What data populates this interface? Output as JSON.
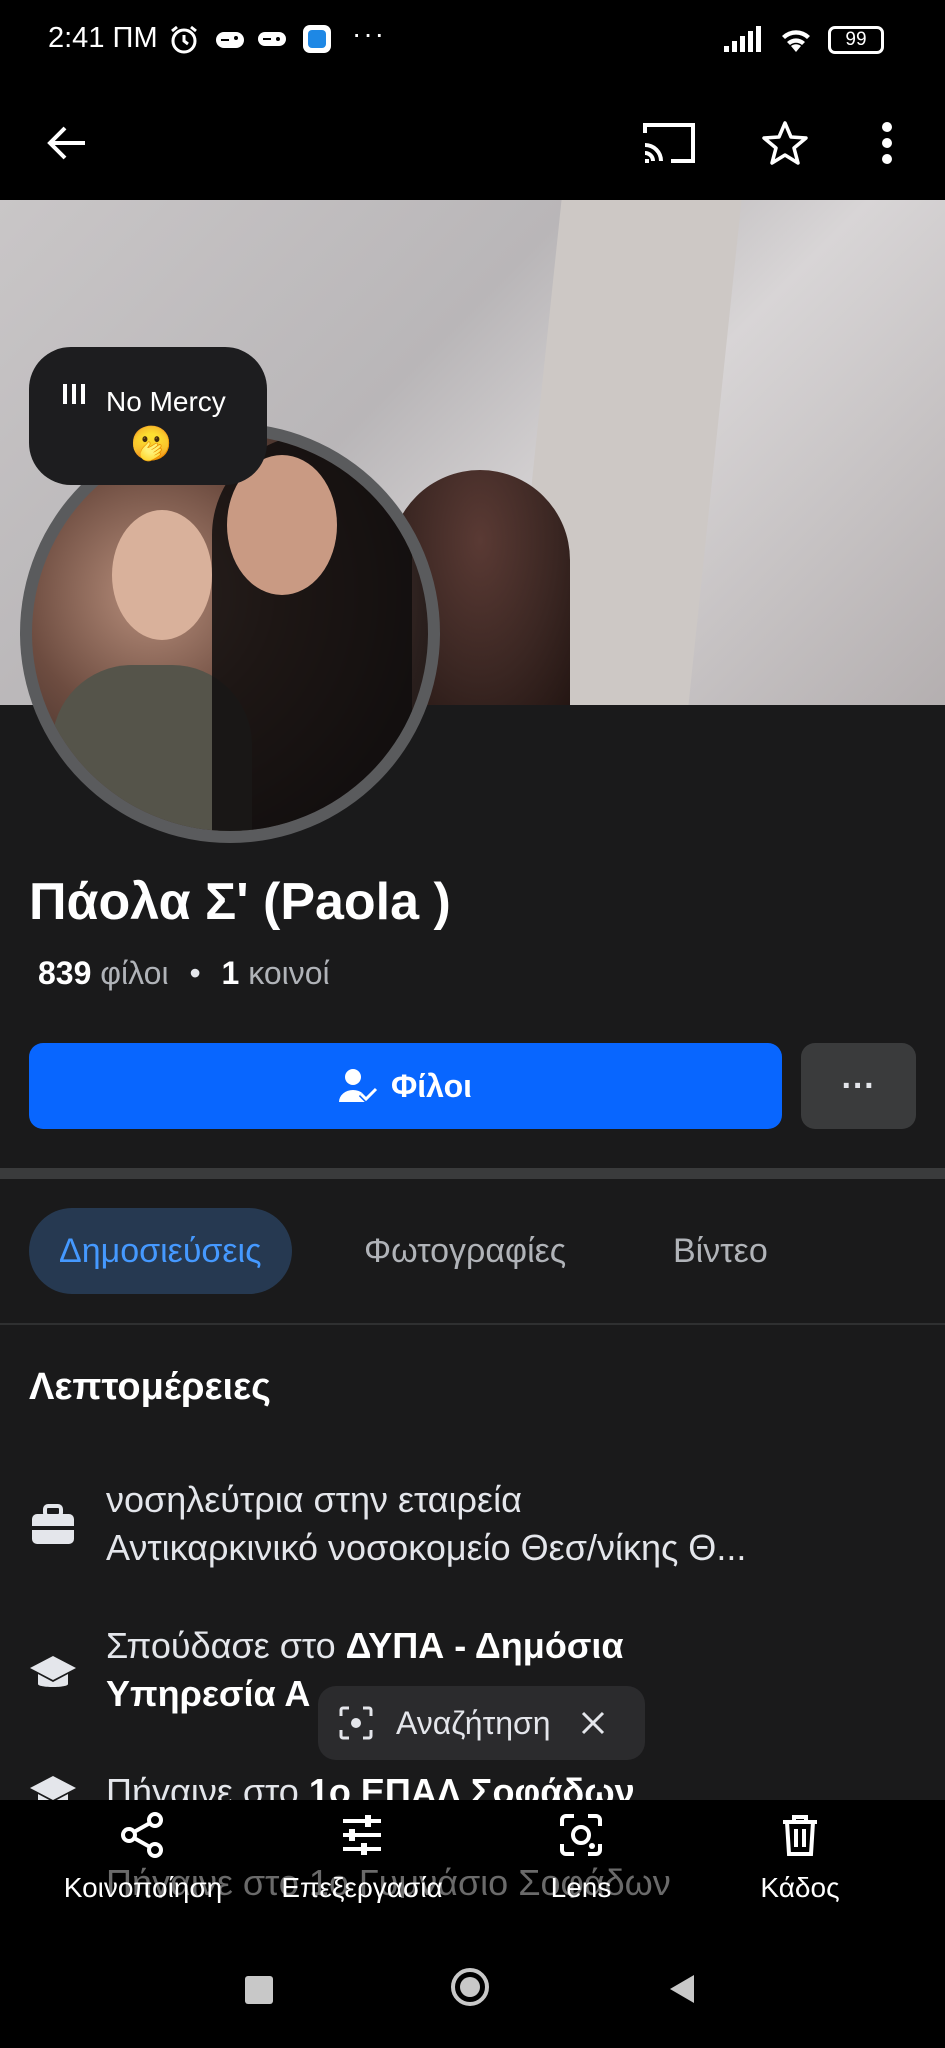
{
  "status_bar": {
    "time": "2:41 ΠΜ",
    "battery": "99",
    "more": "···"
  },
  "profile": {
    "name": "Πάολα Σ' (Paola )",
    "friends_count": "839",
    "friends_word": "φίλοι",
    "separator": "•",
    "mutual_count": "1",
    "mutual_word": "κοινοί",
    "music_title": "No Mercy",
    "music_emoji": "🫢",
    "friends_button_label": "Φίλοι",
    "more_button_label": "···"
  },
  "tabs": [
    {
      "label": "Δημοσιεύσεις",
      "active": true
    },
    {
      "label": "Φωτογραφίες",
      "active": false
    },
    {
      "label": "Βίντεο",
      "active": false
    }
  ],
  "details": {
    "title": "Λεπτομέρειες",
    "work_line1": "νοσηλεύτρια στην εταιρεία",
    "work_line2": "Αντικαρκινικό νοσοκομείο Θεσ/νίκης Θ...",
    "study_prefix": "Σπούδασε στο ",
    "study_bold1": "ΔΥΠΑ - Δημόσια",
    "study_bold2": "Υπηρεσία Α",
    "school_prefix": "Πήγαινε στο ",
    "school_bold": "1ο ΕΠΑΛ Σοφάδων",
    "school2_text": "Πήγαινε στο 1ο Γυμνάσιο Σοφάδων"
  },
  "search_chip": {
    "label": "Αναζήτηση"
  },
  "actions": [
    {
      "label": "Κοινοποίηση",
      "icon": "share-icon"
    },
    {
      "label": "Επεξεργασία",
      "icon": "sliders-icon"
    },
    {
      "label": "Lens",
      "icon": "lens-icon"
    },
    {
      "label": "Κάδος",
      "icon": "trash-icon"
    }
  ],
  "colors": {
    "accent": "#0866ff",
    "active_tab_bg": "#263951",
    "active_tab_text": "#4599ff",
    "background": "#1a1a1b"
  }
}
